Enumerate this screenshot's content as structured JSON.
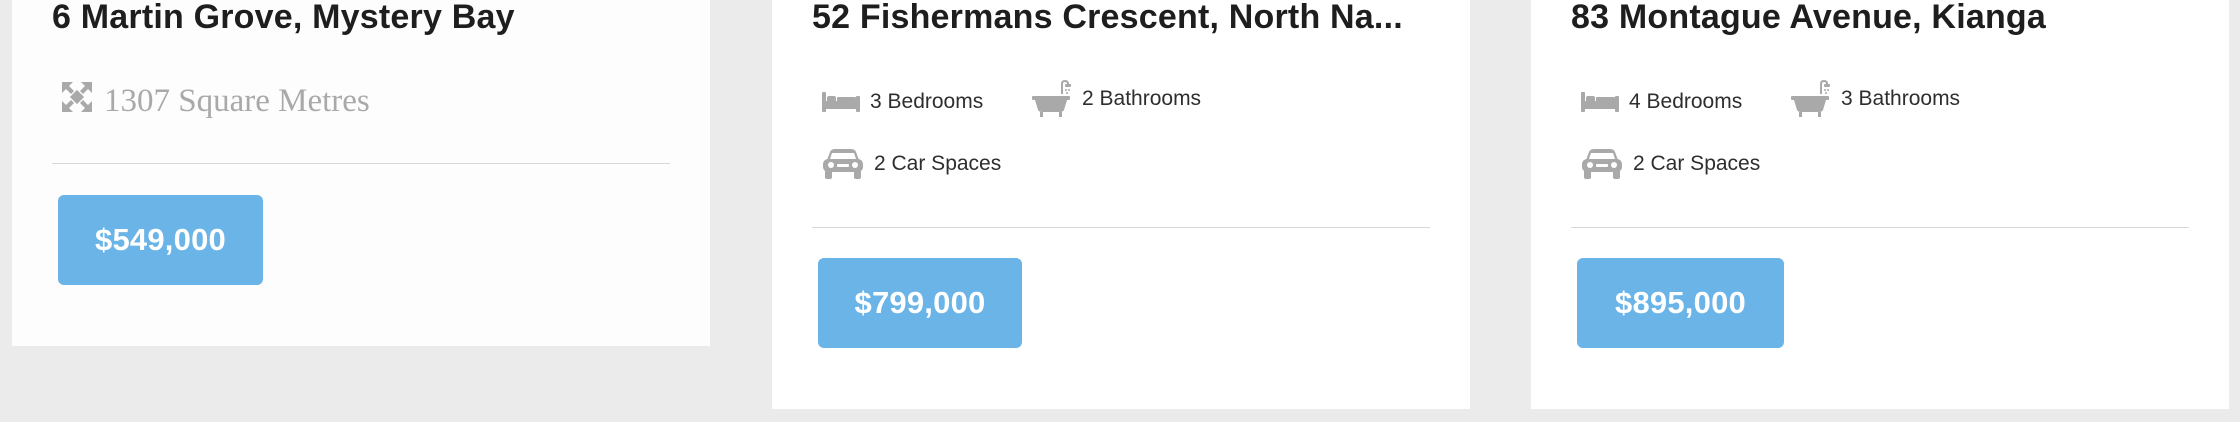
{
  "colors": {
    "page_background": "#ebebeb",
    "card_background": "#ffffff",
    "price_button": "#6ab4e8",
    "icon_grey": "#a9a9a9",
    "divider": "#d8d8d8"
  },
  "listings": [
    {
      "title": "6 Martin Grove, Mystery Bay",
      "area": "1307 Square Metres",
      "area_icon": "expand-arrows-icon",
      "price": "$549,000"
    },
    {
      "title": "52 Fishermans Crescent, North Na...",
      "bedrooms": "3 Bedrooms",
      "bathrooms": "2 Bathrooms",
      "car_spaces": "2 Car Spaces",
      "icons": [
        "bed-icon",
        "bathtub-icon",
        "car-icon"
      ],
      "price": "$799,000"
    },
    {
      "title": "83 Montague Avenue, Kianga",
      "bedrooms": "4 Bedrooms",
      "bathrooms": "3 Bathrooms",
      "car_spaces": "2 Car Spaces",
      "icons": [
        "bed-icon",
        "bathtub-icon",
        "car-icon"
      ],
      "price": "$895,000"
    }
  ]
}
